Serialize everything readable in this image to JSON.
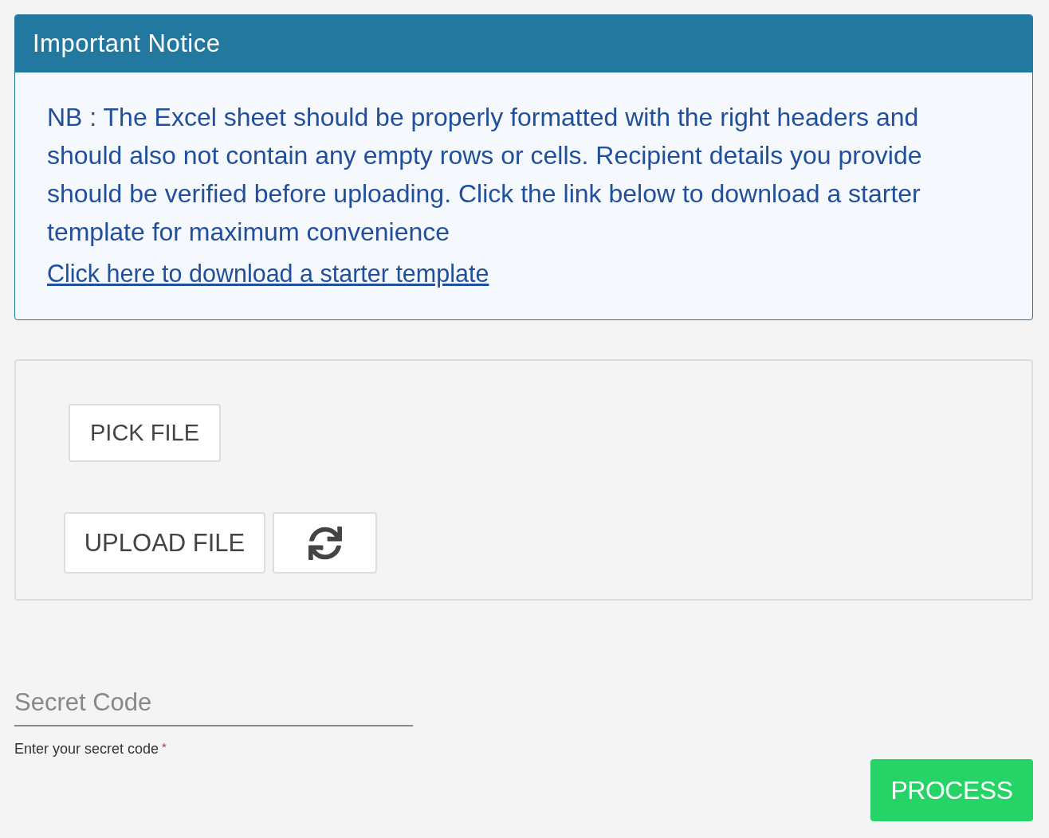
{
  "notice": {
    "title": "Important Notice",
    "message": "NB : The Excel sheet should be properly formatted with the right headers and should also not contain any empty rows or cells. Recipient details you provide should be verified before uploading. Click the link below to download a starter template for maximum convenience",
    "link": "Click here to download a starter template"
  },
  "upload_panel": {
    "pick_button": {
      "label": "PICK FILE"
    },
    "upload_button": {
      "label": "UPLOAD FILE"
    }
  },
  "secret_code": {
    "placeholder": "Secret Code",
    "helper": "Enter your secret code",
    "required_mark": "*"
  },
  "process_button": {
    "label": "PROCESS"
  }
}
